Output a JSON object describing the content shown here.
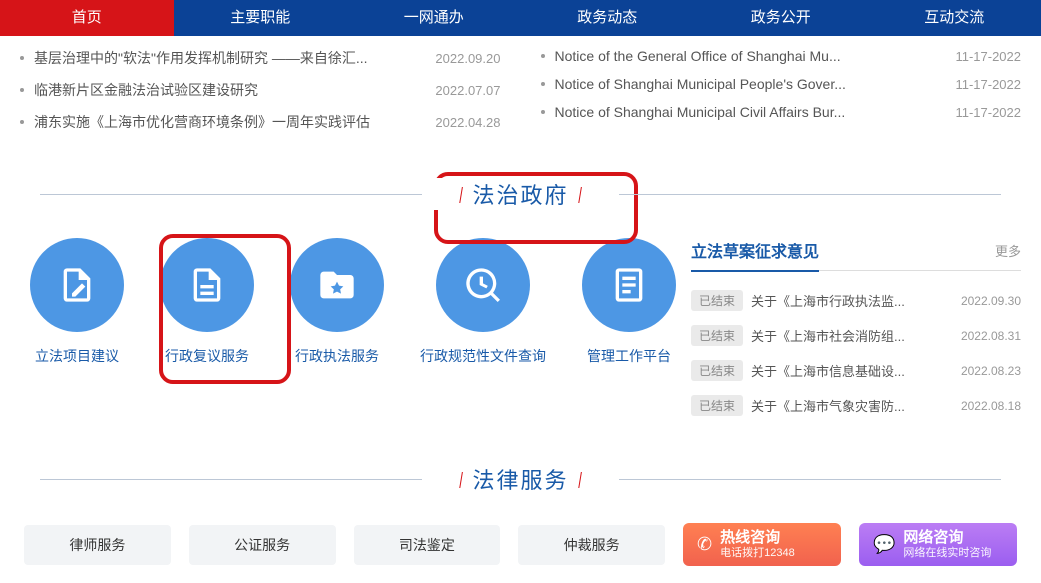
{
  "nav": [
    "首页",
    "主要职能",
    "一网通办",
    "政务动态",
    "政务公开",
    "互动交流"
  ],
  "news_left": [
    {
      "title": "基层治理中的\"软法\"作用发挥机制研究 ——来自徐汇...",
      "date": "2022.09.20"
    },
    {
      "title": "临港新片区金融法治试验区建设研究",
      "date": "2022.07.07"
    },
    {
      "title": "浦东实施《上海市优化营商环境条例》一周年实践评估",
      "date": "2022.04.28"
    }
  ],
  "news_right": [
    {
      "title": "Notice of the General Office of Shanghai Mu...",
      "date": "11-17-2022"
    },
    {
      "title": "Notice of Shanghai Municipal People's Gover...",
      "date": "11-17-2022"
    },
    {
      "title": "Notice of Shanghai Municipal Civil Affairs Bur...",
      "date": "11-17-2022"
    }
  ],
  "section1_title": "法治政府",
  "services": [
    "立法项目建议",
    "行政复议服务",
    "行政执法服务",
    "行政规范性文件查询",
    "管理工作平台"
  ],
  "sidebar": {
    "title": "立法草案征求意见",
    "more": "更多",
    "badge": "已结束",
    "items": [
      {
        "t": "关于《上海市行政执法监...",
        "d": "2022.09.30"
      },
      {
        "t": "关于《上海市社会消防组...",
        "d": "2022.08.31"
      },
      {
        "t": "关于《上海市信息基础设...",
        "d": "2022.08.23"
      },
      {
        "t": "关于《上海市气象灾害防...",
        "d": "2022.08.18"
      }
    ]
  },
  "section2_title": "法律服务",
  "pills": [
    "律师服务",
    "公证服务",
    "司法鉴定",
    "仲裁服务"
  ],
  "hotlines": [
    {
      "main": "热线咨询",
      "sub": "电话拨打12348"
    },
    {
      "main": "网络咨询",
      "sub": "网络在线实时咨询"
    }
  ]
}
